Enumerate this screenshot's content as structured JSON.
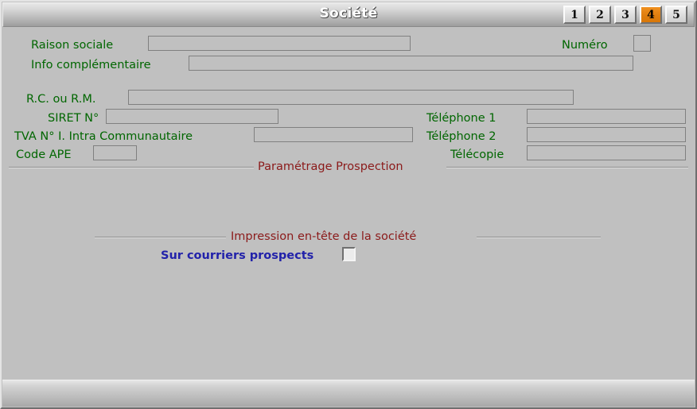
{
  "window": {
    "title": "Société"
  },
  "tabs": [
    {
      "label": "1",
      "active": false
    },
    {
      "label": "2",
      "active": false
    },
    {
      "label": "3",
      "active": false
    },
    {
      "label": "4",
      "active": true
    },
    {
      "label": "5",
      "active": false
    }
  ],
  "form": {
    "raison_sociale": {
      "label": "Raison sociale",
      "value": ""
    },
    "info_complementaire": {
      "label": "Info complémentaire",
      "value": ""
    },
    "numero": {
      "label": "Numéro",
      "value": ""
    },
    "rc_rm": {
      "label": "R.C. ou R.M.",
      "value": ""
    },
    "siret": {
      "label": "SIRET N°",
      "value": ""
    },
    "tva": {
      "label": "TVA N° I. Intra Communautaire",
      "value": ""
    },
    "code_ape": {
      "label": "Code APE",
      "value": ""
    },
    "telephone1": {
      "label": "Téléphone 1",
      "value": ""
    },
    "telephone2": {
      "label": "Téléphone 2",
      "value": ""
    },
    "telecopie": {
      "label": "Télécopie",
      "value": ""
    }
  },
  "sections": {
    "prospection": {
      "title": "Paramétrage Prospection"
    },
    "impression": {
      "title": "Impression en-tête de la société"
    }
  },
  "options": {
    "sur_courriers_prospects": {
      "label": "Sur courriers prospects",
      "checked": false
    }
  },
  "colors": {
    "label_green": "#006600",
    "label_blue": "#2222aa",
    "section_red": "#8b1a1a",
    "tab_active": "#e07f10",
    "window_bg": "#c0c0c0"
  }
}
